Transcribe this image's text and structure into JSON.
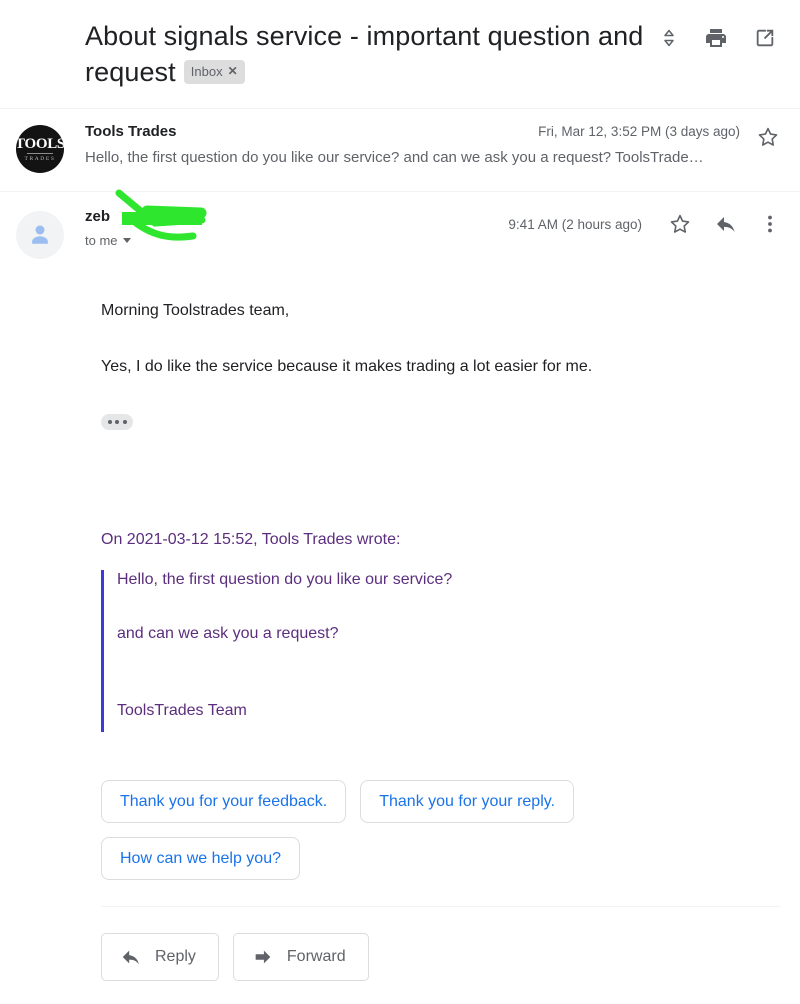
{
  "thread": {
    "subject": "About signals service - important question and request",
    "label": "Inbox",
    "label_remove": "✕"
  },
  "header_actions": [
    {
      "name": "expand-collapse-icon",
      "title": "Expand all"
    },
    {
      "name": "print-icon",
      "title": "Print all"
    },
    {
      "name": "open-in-new-icon",
      "title": "In new window"
    }
  ],
  "messages": {
    "collapsed": {
      "avatar": {
        "line1": "TOOLS",
        "line2": "TRADES"
      },
      "sender": "Tools Trades",
      "date": "Fri, Mar 12, 3:52 PM (3 days ago)",
      "snippet": "Hello, the first question do you like our service? and can we ask you a request? ToolsTrade…",
      "star_icon": "star-outline-icon"
    },
    "expanded": {
      "avatar_icon": "default-person-avatar",
      "sender": "zeb",
      "sender_redacted": true,
      "recipients": "to me",
      "time": "9:41 AM (2 hours ago)",
      "actions": [
        "star-outline-icon",
        "reply-arrow-icon",
        "more-vert-icon"
      ],
      "body": {
        "greeting": "Morning Toolstrades team,",
        "paragraph": "Yes, I do like the service because it makes trading a lot easier for me.",
        "trimmed_content_button": "show-trimmed-content"
      },
      "quote": {
        "intro": "On 2021-03-12 15:52, Tools Trades wrote:",
        "lines": [
          "Hello, the first question do you like our service?",
          "and can we ask you a request?",
          "ToolsTrades Team"
        ],
        "border_color": "#3b3bdb",
        "text_color": "#5c2e7e"
      }
    }
  },
  "smart_replies": {
    "accent_color": "#1a73e8",
    "items": [
      "Thank you for your feedback.",
      "Thank you for your reply.",
      "How can we help you?"
    ]
  },
  "footer": {
    "reply_label": "Reply",
    "forward_label": "Forward"
  },
  "redaction": {
    "color": "#2fe62f"
  }
}
